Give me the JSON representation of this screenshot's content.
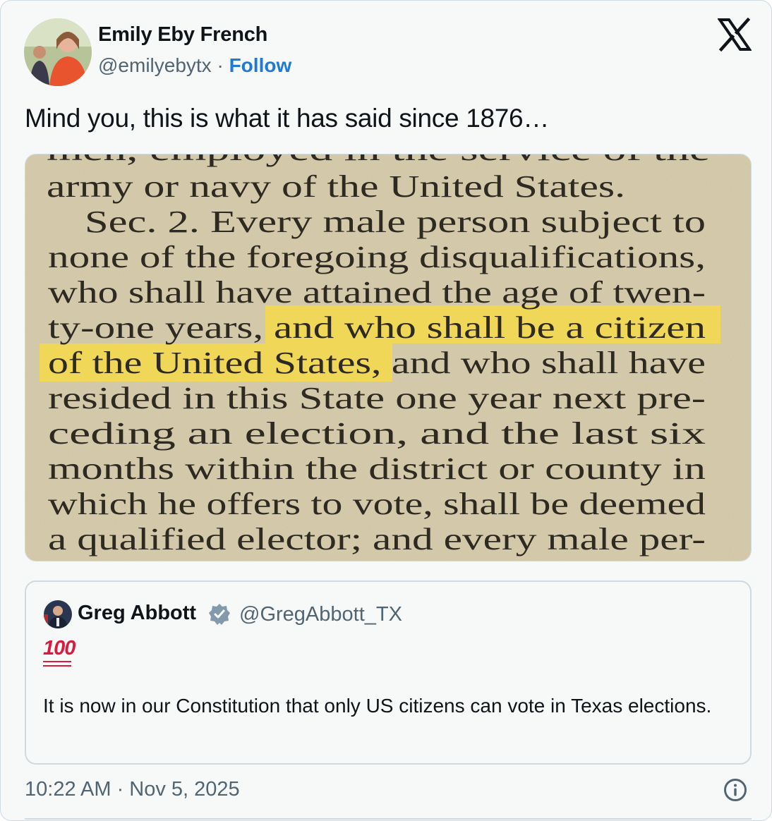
{
  "author": {
    "name": "Emily Eby French",
    "handle": "@emilyebytx",
    "separator": " · ",
    "follow_label": "Follow"
  },
  "logo_icon": "x-logo-icon",
  "tweet": {
    "text": "Mind you, this is what it has said since 1876…",
    "timestamp": "10:22 AM · Nov 5, 2025"
  },
  "media": {
    "lines": [
      "men, employed in the service of the",
      "army or navy of the United States.",
      "Sec. 2. Every male person subject to",
      "none of the foregoing disqualifications,",
      "who shall have attained the age of twen-",
      "ty-one years, and who shall be a citizen",
      "of the United States, and who shall have",
      "resided in this State one year next pre-",
      "ceding an election, and the last six",
      "months within the district or county in",
      "which he offers to vote, shall be deemed",
      "a qualified elector; and every male per-"
    ],
    "highlighted": [
      "and who shall be a citizen",
      "of the United States,"
    ],
    "highlight_color": "#f5d94a"
  },
  "quote": {
    "name": "Greg Abbott",
    "handle": "@GregAbbott_TX",
    "emoji": "100",
    "text": "It is now in our Constitution that only US citizens can vote in Texas elections."
  },
  "colors": {
    "text": "#0f1419",
    "secondary": "#536471",
    "link": "#1d7ad6",
    "border": "#cfd9de",
    "verified": "#829aab",
    "paper": "#d9cfae"
  }
}
